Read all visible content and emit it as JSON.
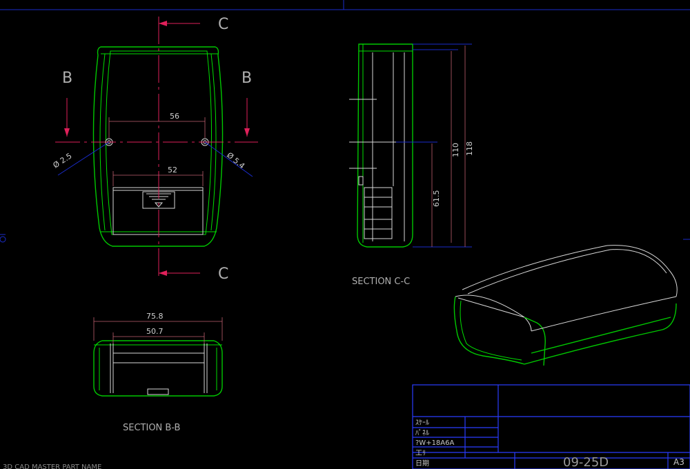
{
  "section_marks": {
    "c_top": "C",
    "c_bottom": "C",
    "b_left": "B",
    "b_right": "B"
  },
  "front_view": {
    "dim_56": "56",
    "dim_52": "52",
    "hole_left": "Ø 2.5",
    "hole_right": "Ø 5.4"
  },
  "section_cc": {
    "title": "SECTION C-C",
    "dim_118": "118",
    "dim_110": "110",
    "dim_61_5": "61.5"
  },
  "section_bb": {
    "title": "SECTION B-B",
    "dim_75_8": "75.8",
    "dim_50_7": "50.7"
  },
  "title_block": {
    "row1": "ｽｹｰﾙ",
    "row2": "ﾊﾟﾈﾙ",
    "row3": "?W+18A6A",
    "row4": "工ﾘ",
    "row5": "日期",
    "drawing_no": "09-25D",
    "sheet_size": "A3"
  },
  "footer_text": "3D CAD MASTER PART NAME",
  "colors": {
    "background": "#000000",
    "outline": "#00c800",
    "detail": "#d8d8d8",
    "dimension": "#c06070",
    "section_arrow": "#e0205a",
    "frame": "#1a2ccc"
  }
}
